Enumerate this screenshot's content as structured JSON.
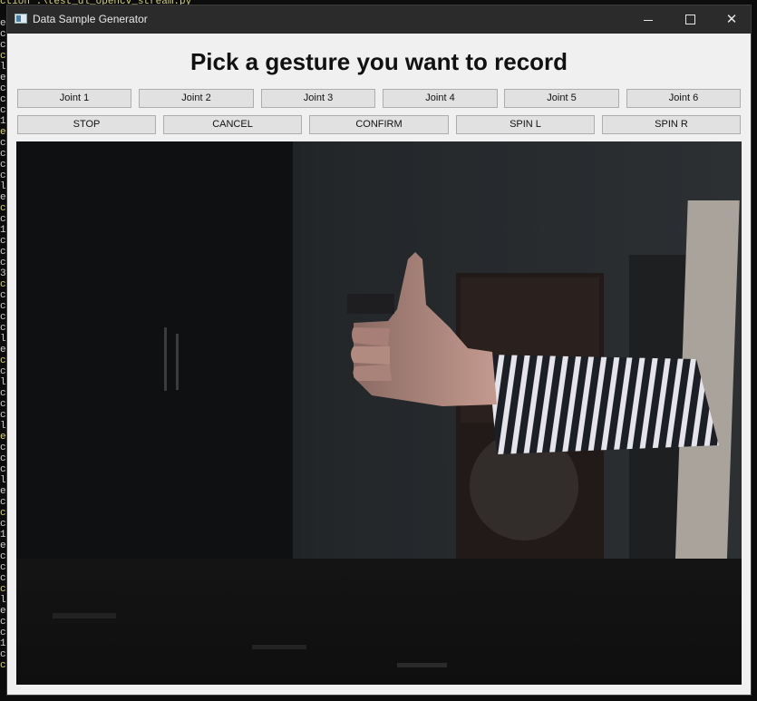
{
  "window": {
    "title": "Data Sample Generator",
    "controls": {
      "minimize": "—",
      "close": "✕"
    }
  },
  "heading": "Pick a gesture you want to record",
  "joint_buttons": [
    {
      "label": "Joint 1"
    },
    {
      "label": "Joint 2"
    },
    {
      "label": "Joint 3"
    },
    {
      "label": "Joint 4"
    },
    {
      "label": "Joint 5"
    },
    {
      "label": "Joint 6"
    }
  ],
  "action_buttons": [
    {
      "label": "STOP"
    },
    {
      "label": "CANCEL"
    },
    {
      "label": "CONFIRM"
    },
    {
      "label": "SPIN L"
    },
    {
      "label": "SPIN R"
    }
  ],
  "background_terminal": {
    "top_line": "ction .\\test_dl_opencv_stream.py"
  },
  "colors": {
    "titlebar": "#2b2b2b",
    "window_bg": "#f0f0f0",
    "button_bg": "#e1e1e1",
    "button_border": "#adadad"
  }
}
